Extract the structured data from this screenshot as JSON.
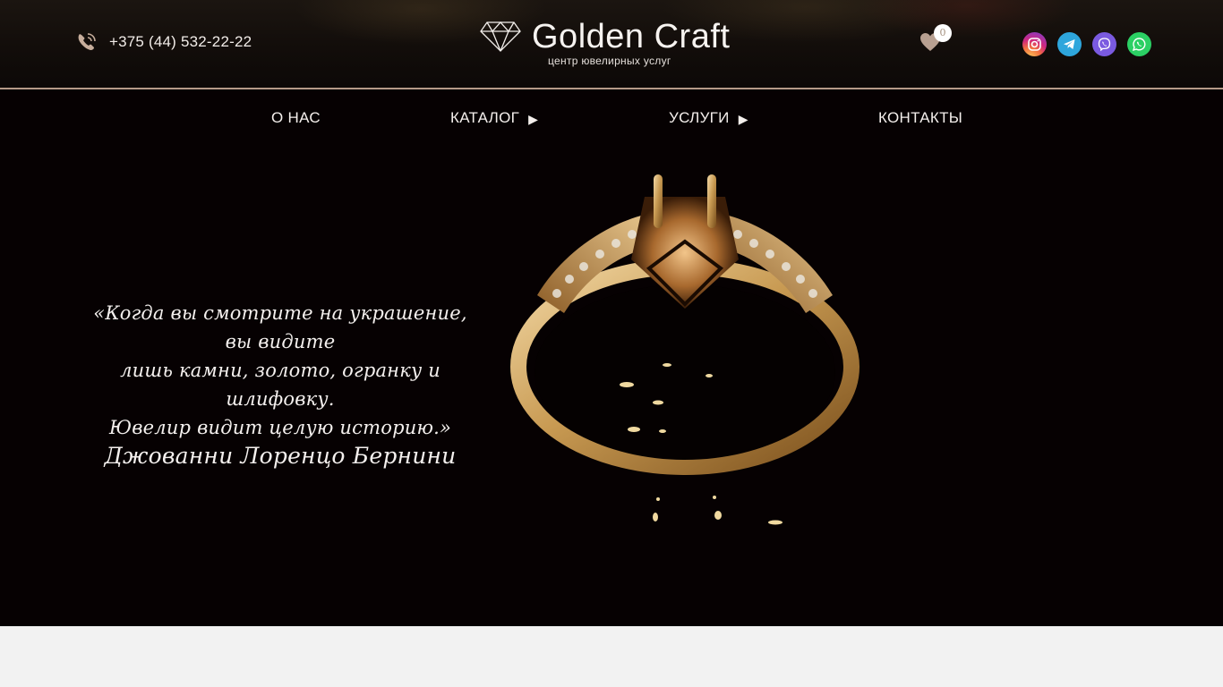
{
  "header": {
    "phone": "+375 (44) 532-22-22",
    "logo_title": "Golden Craft",
    "logo_subtitle": "центр ювелирных услуг",
    "favorites_count": "0",
    "social": [
      "instagram-icon",
      "telegram-icon",
      "viber-icon",
      "whatsapp-icon"
    ]
  },
  "nav": {
    "items": [
      {
        "label": "О НАС"
      },
      {
        "label": "КАТАЛОГ",
        "arrow": "▶"
      },
      {
        "label": "УСЛУГИ",
        "arrow": "▶"
      },
      {
        "label": "КОНТАКТЫ"
      }
    ]
  },
  "hero": {
    "quote_lines": [
      "«Когда вы смотрите на украшение, вы видите",
      "лишь камни, золото, огранку и шлифовку.",
      "Ювелир видит целую историю.»"
    ],
    "quote_author": "Джованни Лоренцо Бернини"
  },
  "colors": {
    "accent": "#b59a88",
    "hero_bg": "#060102",
    "gold": "#c89a52"
  }
}
